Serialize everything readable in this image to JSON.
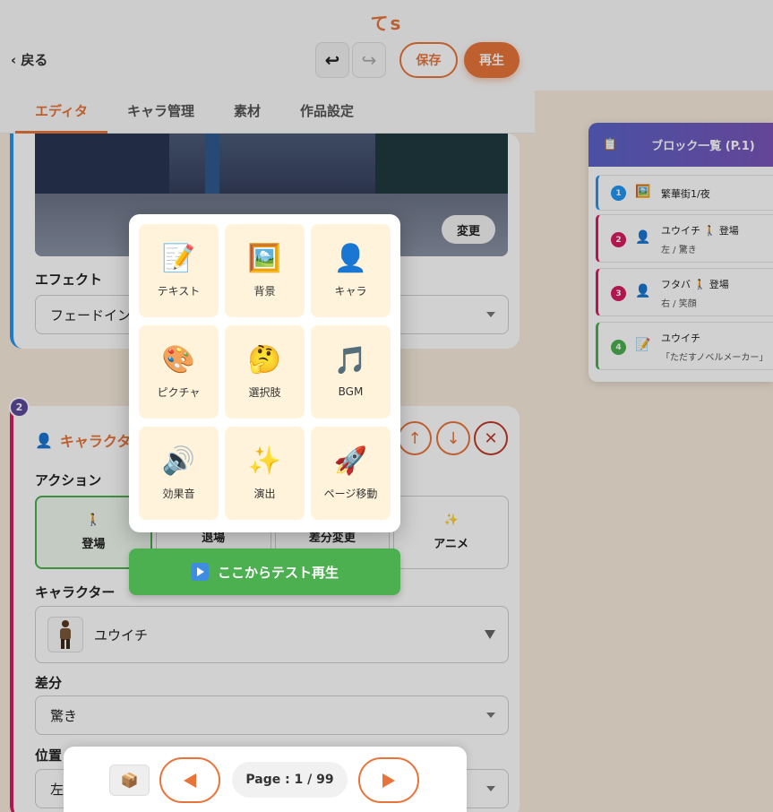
{
  "header": {
    "app_title": "てs",
    "back_label": "‹ 戻る",
    "undo_icon": "undo-icon",
    "redo_icon": "redo-icon",
    "save_label": "保存",
    "play_label": "再生"
  },
  "tabs": [
    {
      "label": "エディタ",
      "active": true
    },
    {
      "label": "キャラ管理",
      "active": false
    },
    {
      "label": "素材",
      "active": false
    },
    {
      "label": "作品設定",
      "active": false
    }
  ],
  "bg_block": {
    "change_label": "変更",
    "effect_label": "エフェクト",
    "effect_value": "フェードイン"
  },
  "char_block": {
    "number": "2",
    "title": "キャラクター",
    "action_label": "アクション",
    "actions": [
      {
        "label": "登場",
        "icon": "🚶",
        "selected": true
      },
      {
        "label": "退場",
        "icon": "",
        "selected": false
      },
      {
        "label": "差分変更",
        "icon": "",
        "selected": false
      },
      {
        "label": "アニメ",
        "icon": "✨",
        "selected": false
      }
    ],
    "character_label": "キャラクター",
    "character_value": "ユウイチ",
    "variant_label": "差分",
    "variant_value": "驚き",
    "position_label": "位置",
    "position_value": "左"
  },
  "block_list": {
    "title": "ブロック一覧 (P.1)",
    "items": [
      {
        "num": "1",
        "color": "#2196f3",
        "icon": "🖼️",
        "text": "繁華街1/夜",
        "sub": ""
      },
      {
        "num": "2",
        "color": "#d81b60",
        "icon": "👤",
        "text": "ユウイチ 🚶 登場",
        "sub": "左 / 驚き"
      },
      {
        "num": "3",
        "color": "#d81b60",
        "icon": "👤",
        "text": "フタバ 🚶 登場",
        "sub": "右 / 笑顔"
      },
      {
        "num": "4",
        "color": "#4caf50",
        "icon": "📝",
        "text": "ユウイチ",
        "sub": "「ただすノベルメーカー」"
      }
    ]
  },
  "add_menu": {
    "items": [
      {
        "label": "テキスト",
        "icon": "📝"
      },
      {
        "label": "背景",
        "icon": "🖼️"
      },
      {
        "label": "キャラ",
        "icon": "👤"
      },
      {
        "label": "ピクチャ",
        "icon": "🎨"
      },
      {
        "label": "選択肢",
        "icon": "🤔"
      },
      {
        "label": "BGM",
        "icon": "🎵"
      },
      {
        "label": "効果音",
        "icon": "🔊"
      },
      {
        "label": "演出",
        "icon": "✨"
      },
      {
        "label": "ページ移動",
        "icon": "🚀"
      }
    ],
    "test_play_label": "ここからテスト再生"
  },
  "pager": {
    "page_indicator": "Page : 1 / 99"
  },
  "colors": {
    "accent": "#e8743b",
    "green": "#4caf50",
    "blue": "#2196f3",
    "magenta": "#d81b60"
  }
}
